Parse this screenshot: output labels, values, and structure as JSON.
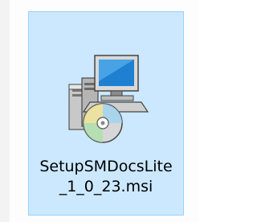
{
  "file": {
    "name_line1": "SetupSMDocsLite",
    "name_line2": "_1_0_23.msi",
    "icon": "msi-installer-icon",
    "selected": true
  },
  "colors": {
    "selection_fill": "#cce8ff",
    "selection_border": "#99d1ff"
  }
}
